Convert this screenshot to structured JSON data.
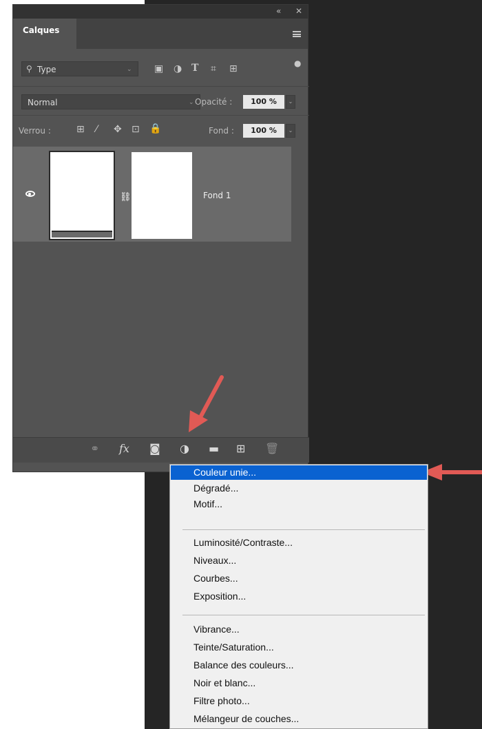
{
  "panel": {
    "tab": "Calques",
    "collapse": "«",
    "close": "✕",
    "filter": {
      "label": "Type"
    },
    "blend_mode": "Normal",
    "opacity_label": "Opacité :",
    "opacity_value": "100 %",
    "lock_label": "Verrou :",
    "fill_label": "Fond :",
    "fill_value": "100 %",
    "layers": [
      {
        "name": "Fond 1"
      }
    ]
  },
  "menu": {
    "items": [
      "Couleur unie...",
      "Dégradé...",
      "Motif...",
      "Luminosité/Contraste...",
      "Niveaux...",
      "Courbes...",
      "Exposition...",
      "Vibrance...",
      "Teinte/Saturation...",
      "Balance des couleurs...",
      "Noir et blanc...",
      "Filtre photo...",
      "Mélangeur de couches..."
    ],
    "selected": "Couleur unie..."
  },
  "colors": {
    "panel": "#535353",
    "selection": "#0a62d1",
    "annotation_arrow": "#e15a55"
  }
}
